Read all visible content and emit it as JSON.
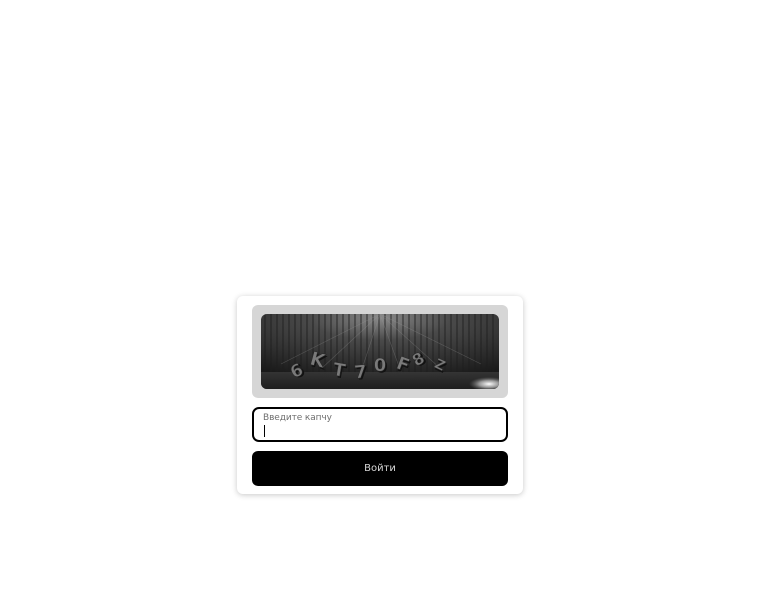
{
  "captcha": {
    "text": "6KT70F8Z",
    "characters": [
      "6",
      "K",
      "T",
      "7",
      "0",
      "F",
      "8",
      "Z"
    ]
  },
  "field": {
    "label": "Введите капчу",
    "value": ""
  },
  "submit": {
    "label": "Войти"
  },
  "colors": {
    "frame": "#d6d6d6",
    "field_border": "#000000",
    "button_bg": "#000000",
    "button_text": "#d8d8d8",
    "label": "#6f6f6f"
  }
}
